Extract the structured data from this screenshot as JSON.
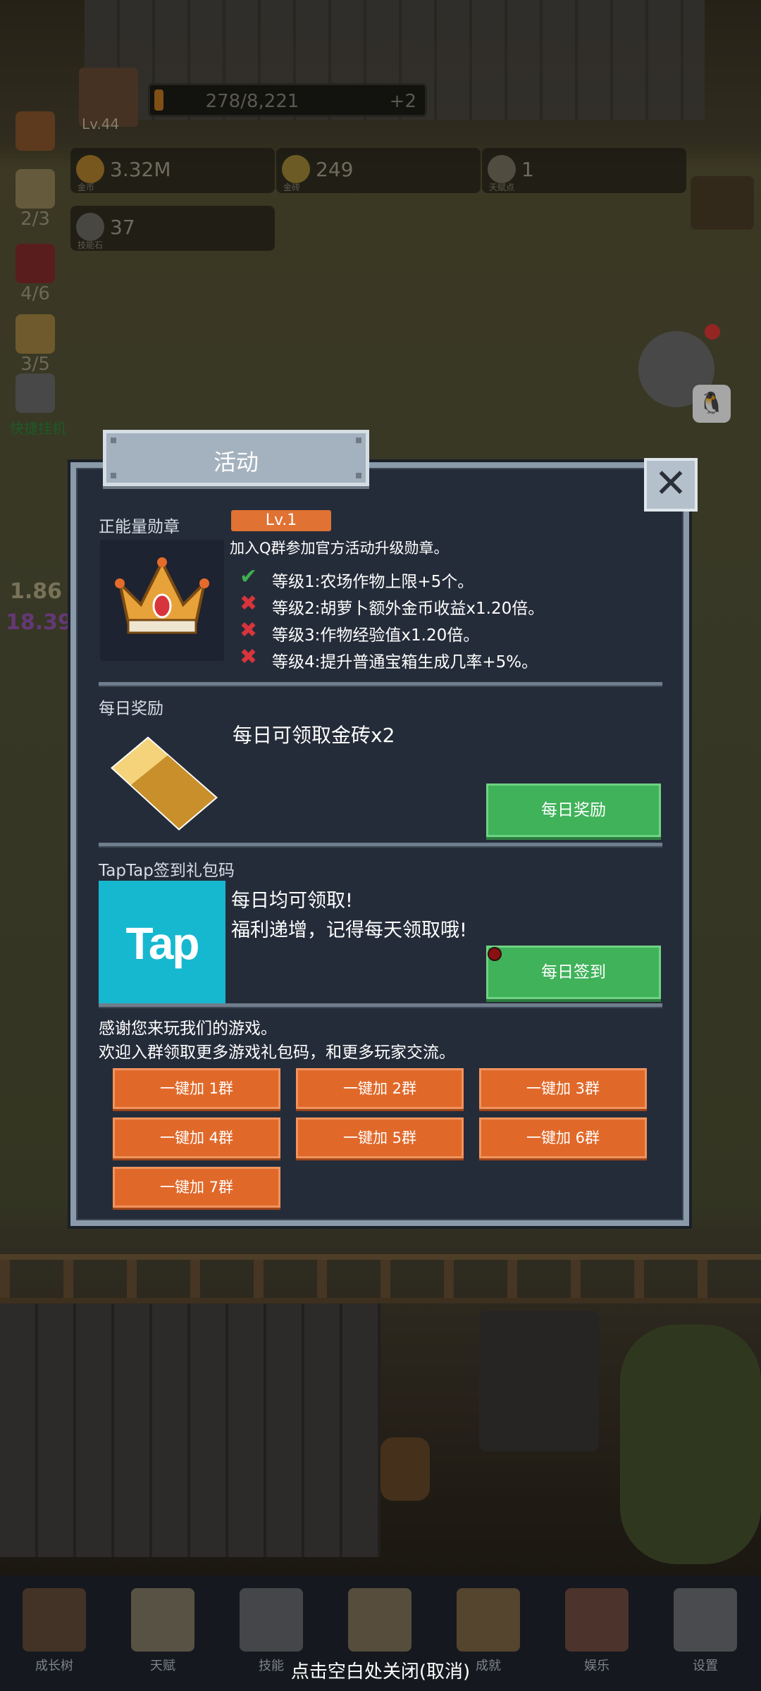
{
  "hud": {
    "level": "Lv.44",
    "exp_text": "278/8,221",
    "exp_fraction": 0.034,
    "exp_plus": "+2",
    "resources": [
      {
        "value": "3.32M",
        "caption": "金币"
      },
      {
        "value": "249",
        "caption": "金砖"
      },
      {
        "value": "1",
        "caption": "天赋点"
      },
      {
        "value": "37",
        "caption": "技能石"
      }
    ],
    "side": [
      {
        "count": "2/3"
      },
      {
        "count": "4/6"
      },
      {
        "count": "3/5"
      }
    ],
    "side_label": "快捷挂机",
    "left_num1": "1.86",
    "left_num2": "18.39"
  },
  "dialog": {
    "title": "活动",
    "close": "✕",
    "medal": {
      "label": "正能量勋章",
      "level": "Lv.1",
      "desc": "加入Q群参加官方活动升级勋章。",
      "levels": [
        {
          "text": "等级1:农场作物上限+5个。",
          "unlocked": true
        },
        {
          "text": "等级2:胡萝卜额外金币收益x1.20倍。",
          "unlocked": false
        },
        {
          "text": "等级3:作物经验值x1.20倍。",
          "unlocked": false
        },
        {
          "text": "等级4:提升普通宝箱生成几率+5%。",
          "unlocked": false
        }
      ]
    },
    "daily": {
      "label": "每日奖励",
      "text": "每日可领取金砖x2",
      "button": "每日奖励"
    },
    "taptap": {
      "label": "TapTap签到礼包码",
      "logo": "Tap",
      "line1": "每日均可领取!",
      "line2": "福利递增，记得每天领取哦!",
      "button": "每日签到"
    },
    "thanks1": "感谢您来玩我们的游戏。",
    "thanks2": "欢迎入群领取更多游戏礼包码，和更多玩家交流。",
    "groups": [
      "一键加 1群",
      "一键加 2群",
      "一键加 3群",
      "一键加 4群",
      "一键加 5群",
      "一键加 6群",
      "一键加 7群"
    ]
  },
  "nav": [
    "成长树",
    "天赋",
    "技能",
    "",
    "成就",
    "娱乐",
    "设置"
  ],
  "close_hint": "点击空白处关闭(取消)",
  "colors": {
    "accent_orange": "#e07233",
    "accent_green": "#40b25a",
    "panel": "#252c39"
  }
}
